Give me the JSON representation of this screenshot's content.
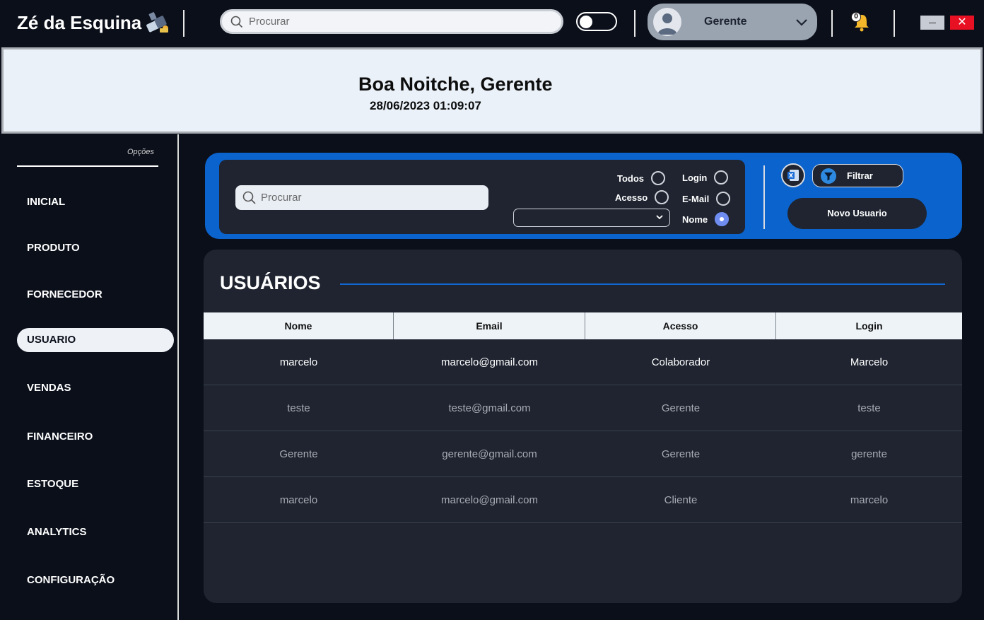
{
  "app": {
    "title": "Zé da Esquina"
  },
  "topbar": {
    "search_placeholder": "Procurar",
    "user_name": "Gerente",
    "notification_count": "0"
  },
  "banner": {
    "greeting": "Boa Noitche, Gerente",
    "datetime": "28/06/2023 01:09:07"
  },
  "sidebar": {
    "header": "Opções",
    "items": [
      {
        "label": "INICIAL"
      },
      {
        "label": "PRODUTO"
      },
      {
        "label": "FORNECEDOR"
      },
      {
        "label": "USUARIO",
        "active": true
      },
      {
        "label": "VENDAS"
      },
      {
        "label": "FINANCEIRO"
      },
      {
        "label": "ESTOQUE"
      },
      {
        "label": "ANALYTICS"
      },
      {
        "label": "CONFIGURAÇÃO"
      }
    ]
  },
  "filter": {
    "search_placeholder": "Procurar",
    "dropdown_value": "",
    "radios": [
      {
        "label": "Todos",
        "checked": false
      },
      {
        "label": "Acesso",
        "checked": false
      },
      {
        "label": "Login",
        "checked": false
      },
      {
        "label": "E-Mail",
        "checked": false
      },
      {
        "label": "Nome",
        "checked": true
      }
    ],
    "filter_button": "Filtrar",
    "new_user_button": "Novo Usuario"
  },
  "users": {
    "title": "USUÁRIOS",
    "columns": [
      "Nome",
      "Email",
      "Acesso",
      "Login"
    ],
    "rows": [
      [
        "marcelo",
        "marcelo@gmail.com",
        "Colaborador",
        "Marcelo"
      ],
      [
        "teste",
        "teste@gmail.com",
        "Gerente",
        "teste"
      ],
      [
        "Gerente",
        "gerente@gmail.com",
        "Gerente",
        "gerente"
      ],
      [
        "marcelo",
        "marcelo@gmail.com",
        "Cliente",
        "marcelo"
      ]
    ]
  },
  "colors": {
    "background": "#0b0f1a",
    "panel": "#1f2430",
    "accent_blue": "#0b63ce",
    "banner": "#eaf1f8",
    "close_red": "#e81123"
  }
}
